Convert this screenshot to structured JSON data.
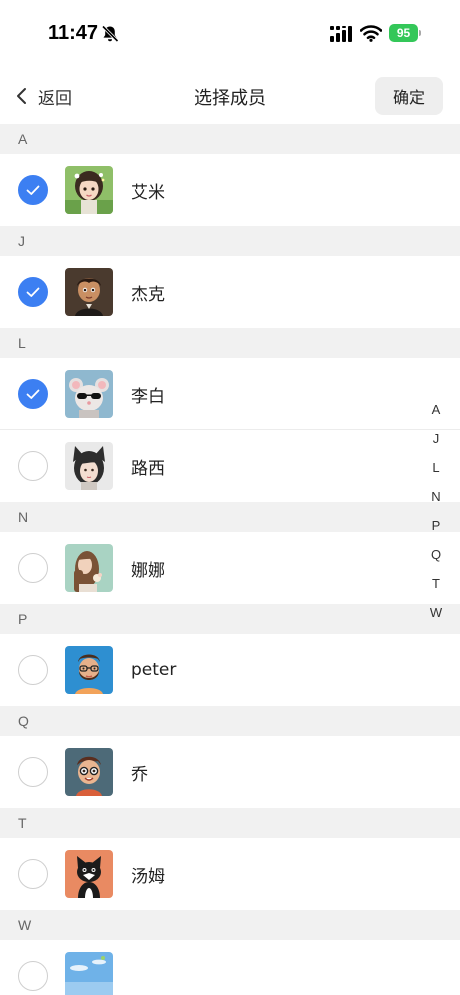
{
  "status_bar": {
    "time": "11:47",
    "battery": "95"
  },
  "nav": {
    "back_label": "返回",
    "title": "选择成员",
    "confirm_label": "确定"
  },
  "colors": {
    "accent": "#3c7ff2",
    "battery": "#34c759",
    "section_bg": "#f1f1f1"
  },
  "icons": {
    "bell": "bell-slash-icon",
    "signal": "signal-icon",
    "wifi": "wifi-icon",
    "back": "chevron-left-icon",
    "check": "checkmark-icon"
  },
  "sections": [
    {
      "letter": "A",
      "contacts": [
        {
          "name": "艾米",
          "selected": true,
          "avatar": "girl-flowers-avatar"
        }
      ]
    },
    {
      "letter": "J",
      "contacts": [
        {
          "name": "杰克",
          "selected": true,
          "avatar": "boy-avatar"
        }
      ]
    },
    {
      "letter": "L",
      "contacts": [
        {
          "name": "李白",
          "selected": true,
          "avatar": "mouse-sunglasses-avatar"
        },
        {
          "name": "路西",
          "selected": false,
          "avatar": "cat-ear-girl-avatar"
        }
      ]
    },
    {
      "letter": "N",
      "contacts": [
        {
          "name": "娜娜",
          "selected": false,
          "avatar": "long-hair-girl-avatar"
        }
      ]
    },
    {
      "letter": "P",
      "contacts": [
        {
          "name": "peter",
          "selected": false,
          "avatar": "bearded-man-avatar"
        }
      ]
    },
    {
      "letter": "Q",
      "contacts": [
        {
          "name": "乔",
          "selected": false,
          "avatar": "glasses-boy-avatar"
        }
      ]
    },
    {
      "letter": "T",
      "contacts": [
        {
          "name": "汤姆",
          "selected": false,
          "avatar": "black-cat-avatar"
        }
      ]
    },
    {
      "letter": "W",
      "contacts": [
        {
          "name": "",
          "selected": false,
          "avatar": "sky-avatar"
        }
      ]
    }
  ],
  "index_letters": [
    "A",
    "J",
    "L",
    "N",
    "P",
    "Q",
    "T",
    "W"
  ]
}
